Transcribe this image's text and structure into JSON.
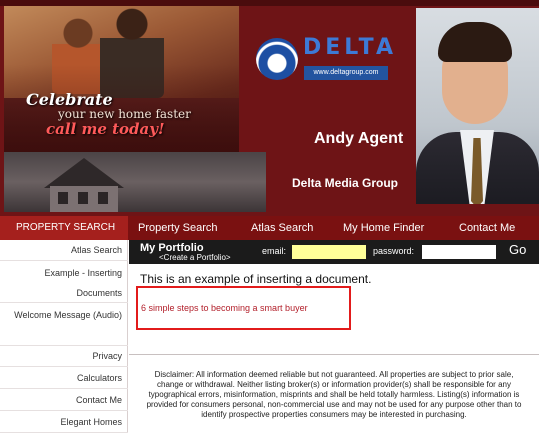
{
  "header": {
    "tagline_celebrate": "Celebrate",
    "tagline_sub": "your new home faster",
    "tagline_call": "call me today!",
    "logo_name": "DELTA",
    "logo_url": "www.deltagroup.com",
    "agent_name": "Andy Agent",
    "company_name": "Delta Media Group"
  },
  "nav": {
    "section_label": "PROPERTY SEARCH",
    "links": [
      "Property Search",
      "Atlas Search",
      "My Home Finder",
      "Contact Me"
    ]
  },
  "sidebar": {
    "items": [
      {
        "label": "Atlas Search"
      },
      {
        "label": "Example - Inserting Documents"
      },
      {
        "label": "Welcome Message (Audio)"
      },
      {
        "label": "Privacy"
      },
      {
        "label": "Calculators"
      },
      {
        "label": "Contact Me"
      },
      {
        "label": "Elegant Homes"
      }
    ]
  },
  "portfolio": {
    "title": "My Portfolio",
    "create_link": "<Create a Portfolio>",
    "email_label": "email:",
    "email_value": "",
    "password_label": "password:",
    "password_value": "",
    "go_label": "Go"
  },
  "main": {
    "intro": "This is an example of inserting a document.",
    "article_link": "6 simple steps to becoming a smart buyer",
    "disclaimer": "Disclaimer: All information deemed reliable but not guaranteed. All properties are subject to prior sale, change or withdrawal. Neither listing broker(s) or information provider(s) shall be responsible for any typographical errors, misinformation, misprints and shall be held totally harmless. Listing(s) information is provided for consumers personal, non-commercial use and may not be used for any purpose other than to identify prospective properties consumers may be interested in purchasing."
  },
  "colors": {
    "header_bg": "#6e1416",
    "nav_bg": "#7a1111",
    "nav_active_bg": "#a5201d",
    "portfolio_bar_bg": "#1b1b1b",
    "email_field_bg": "#ffff99",
    "highlight_border": "#e21b1b",
    "link_color": "#b21f2a",
    "logo_blue": "#3d7ad6"
  },
  "icons": {
    "logo": "delta-logo-icon"
  }
}
